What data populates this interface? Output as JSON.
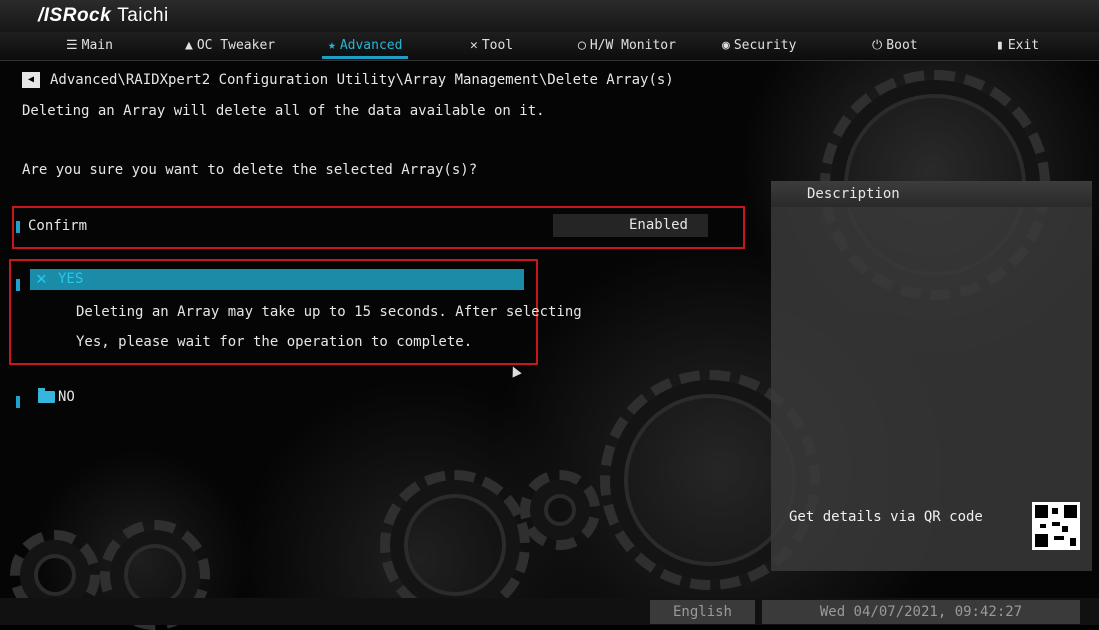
{
  "app": {
    "brand": "/ISRock",
    "model": "Taichi"
  },
  "menu": {
    "items": [
      {
        "icon": "list-icon",
        "glyph": "☰",
        "label": "Main"
      },
      {
        "icon": "rocket-icon",
        "glyph": "▲",
        "label": "OC Tweaker"
      },
      {
        "icon": "star-icon",
        "glyph": "★",
        "label": "Advanced"
      },
      {
        "icon": "tools-icon",
        "glyph": "✕",
        "label": "Tool"
      },
      {
        "icon": "monitor-icon",
        "glyph": "◯",
        "label": "H/W Monitor"
      },
      {
        "icon": "shield-icon",
        "glyph": "◉",
        "label": "Security"
      },
      {
        "icon": "power-icon",
        "glyph": "⏻",
        "label": "Boot"
      },
      {
        "icon": "exit-icon",
        "glyph": "▮",
        "label": "Exit"
      }
    ],
    "active": "Advanced",
    "accent_color": "#1e9ec4"
  },
  "breadcrumb": "Advanced\\RAIDXpert2 Configuration Utility\\Array Management\\Delete Array(s)",
  "warning_line": "Deleting an Array will delete all of the data available on it.",
  "question_line": "Are you sure you want to delete the selected Array(s)?",
  "confirm": {
    "label": "Confirm",
    "value": "Enabled"
  },
  "yes_option": {
    "label": "YES",
    "help_line1": "Deleting an Array may take up to 15 seconds. After selecting",
    "help_line2": "Yes, please wait for the operation to complete."
  },
  "no_option": {
    "label": "NO"
  },
  "description": {
    "title": "Description",
    "qr_text": "Get details via QR code"
  },
  "status": {
    "language": "English",
    "datetime": "Wed 04/07/2021, 09:42:27"
  },
  "colors": {
    "highlight_outline": "#c8161d",
    "selected_row": "#1b8ca8"
  }
}
